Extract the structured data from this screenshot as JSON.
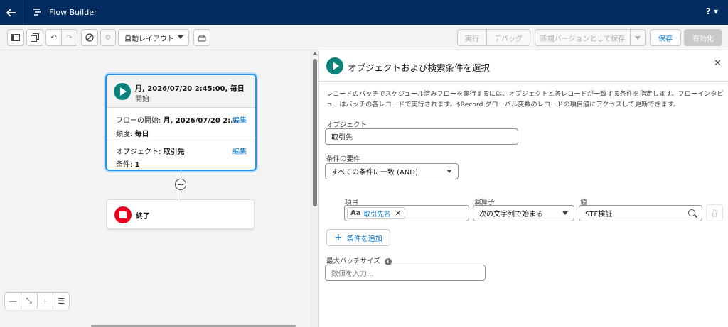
{
  "header": {
    "app_title": "Flow Builder",
    "help_label": "?"
  },
  "toolbar": {
    "layout_select": "自動レイアウト",
    "run_label": "実行",
    "debug_label": "デバッグ",
    "save_as_new_label": "新規バージョンとして保存",
    "save_label": "保存",
    "activate_label": "有効化"
  },
  "start_node": {
    "title": "月, 2026/07/20 2:45:00, 毎日",
    "subtitle": "開始",
    "flow_start_label": "フローの開始:",
    "flow_start_value": "月, 2026/07/20 2:...",
    "frequency_label": "頻度:",
    "frequency_value": "毎日",
    "object_label": "オブジェクト:",
    "object_value": "取引先",
    "conditions_label": "条件:",
    "conditions_value": "1",
    "edit_label": "編集"
  },
  "end_node": {
    "label": "終了"
  },
  "panel": {
    "title": "オブジェクトおよび検索条件を選択",
    "description": "レコードのバッチでスケジュール済みフローを実行するには、オブジェクトと各レコードが一致する条件を指定します。フローインタビューはバッチの各レコードで実行されます。$Record グローバル変数のレコードの項目値にアクセスして更新できます。",
    "object_label": "オブジェクト",
    "object_value": "取引先",
    "condition_req_label": "条件の要件",
    "condition_req_value": "すべての条件に一致 (AND)",
    "field_col_label": "項目",
    "operator_col_label": "演算子",
    "value_col_label": "値",
    "condition": {
      "field_value": "取引先名",
      "operator_value": "次の文字列で始まる",
      "value": "STF検証"
    },
    "add_condition_label": "条件を追加",
    "batch_size_label": "最大バッチサイズ",
    "batch_size_placeholder": "数値を入力..."
  }
}
